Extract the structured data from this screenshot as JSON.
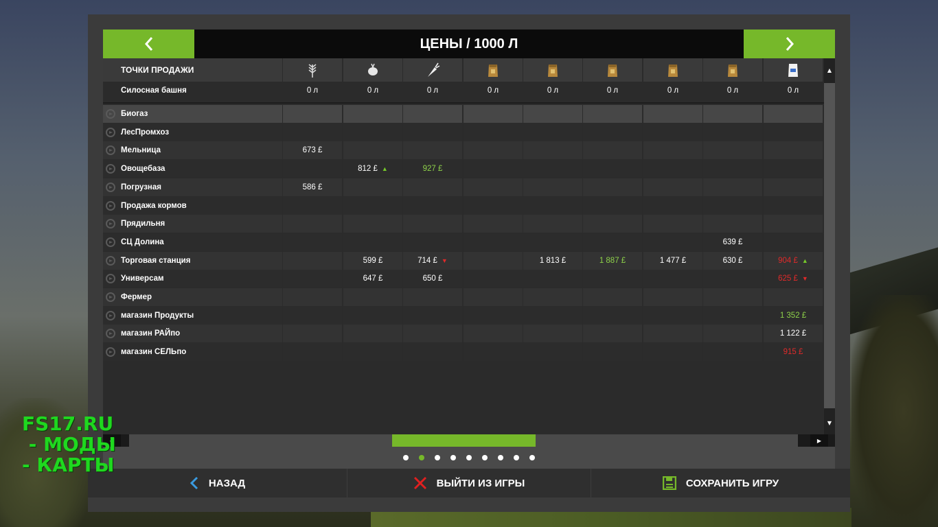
{
  "header": {
    "title": "ЦЕНЫ / 1000 Л"
  },
  "table": {
    "header_label": "ТОЧКИ ПРОДАЖИ",
    "columns": [
      {
        "icon": "wheat-icon"
      },
      {
        "icon": "potato-icon"
      },
      {
        "icon": "sugarbeet-icon"
      },
      {
        "icon": "grain-sack-icon"
      },
      {
        "icon": "grain-sack-icon"
      },
      {
        "icon": "grain-sack-icon"
      },
      {
        "icon": "grain-sack-icon"
      },
      {
        "icon": "grain-sack-icon"
      },
      {
        "icon": "flour-bag-icon"
      }
    ],
    "silo": {
      "name": "Силосная башня",
      "values": [
        "0 л",
        "0 л",
        "0 л",
        "0 л",
        "0 л",
        "0 л",
        "0 л",
        "0 л",
        "0 л"
      ]
    },
    "rows": [
      {
        "name": "Биогаз",
        "cells": [
          "",
          "",
          "",
          "",
          "",
          "",
          "",
          "",
          ""
        ]
      },
      {
        "name": "ЛесПромхоз",
        "cells": [
          "",
          "",
          "",
          "",
          "",
          "",
          "",
          "",
          ""
        ]
      },
      {
        "name": "Мельница",
        "cells": [
          "673 £",
          "",
          "",
          "",
          "",
          "",
          "",
          "",
          ""
        ]
      },
      {
        "name": "Овощебаза",
        "cells": [
          "",
          "812 £",
          "927 £",
          "",
          "",
          "",
          "",
          "",
          ""
        ]
      },
      {
        "name": "Погрузная",
        "cells": [
          "586 £",
          "",
          "",
          "",
          "",
          "",
          "",
          "",
          ""
        ]
      },
      {
        "name": "Продажа кормов",
        "cells": [
          "",
          "",
          "",
          "",
          "",
          "",
          "",
          "",
          ""
        ]
      },
      {
        "name": "Прядильня",
        "cells": [
          "",
          "",
          "",
          "",
          "",
          "",
          "",
          "",
          ""
        ]
      },
      {
        "name": "СЦ Долина",
        "cells": [
          "",
          "",
          "",
          "",
          "",
          "",
          "",
          "639 £",
          ""
        ]
      },
      {
        "name": "Торговая станция",
        "cells": [
          "",
          "599 £",
          "714 £",
          "",
          "1 813 £",
          "1 887 £",
          "1 477 £",
          "630 £",
          "904 £"
        ]
      },
      {
        "name": "Универсам",
        "cells": [
          "",
          "647 £",
          "650 £",
          "",
          "",
          "",
          "",
          "",
          "625 £"
        ]
      },
      {
        "name": "Фермер",
        "cells": [
          "",
          "",
          "",
          "",
          "",
          "",
          "",
          "",
          ""
        ]
      },
      {
        "name": "магазин Продукты",
        "cells": [
          "",
          "",
          "",
          "",
          "",
          "",
          "",
          "",
          "1 352 £"
        ]
      },
      {
        "name": "магазин РАЙпо",
        "cells": [
          "",
          "",
          "",
          "",
          "",
          "",
          "",
          "",
          "1 122 £"
        ]
      },
      {
        "name": "магазин СЕЛЬпо",
        "cells": [
          "",
          "",
          "",
          "",
          "",
          "",
          "",
          "",
          "915 £"
        ]
      }
    ],
    "highlights": {
      "green": [
        [
          3,
          2
        ],
        [
          8,
          5
        ],
        [
          11,
          8
        ]
      ],
      "red": [
        [
          8,
          8
        ],
        [
          9,
          8
        ],
        [
          13,
          8
        ]
      ],
      "arrow_up": [
        [
          3,
          1
        ],
        [
          8,
          8
        ]
      ],
      "arrow_down": [
        [
          8,
          2
        ],
        [
          9,
          8
        ]
      ]
    }
  },
  "pagination": {
    "pages": 9,
    "active": 2
  },
  "footer": {
    "back_label": "НАЗАД",
    "quit_label": "ВЫЙТИ ИЗ ИГРЫ",
    "save_label": "СОХРАНИТЬ ИГРУ"
  },
  "watermark": {
    "lines": [
      "FS17.RU",
      " - МОДЫ",
      "- КАРТЫ"
    ]
  },
  "colors": {
    "accent": "#76b82a",
    "positive": "#8ed24a",
    "negative": "#e02a2a"
  }
}
